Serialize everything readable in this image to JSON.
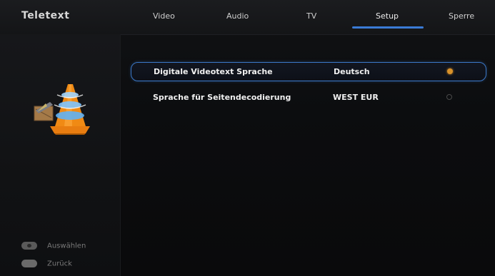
{
  "header": {
    "section_title": "Teletext",
    "tabs": [
      {
        "label": "Video"
      },
      {
        "label": "Audio"
      },
      {
        "label": "TV"
      },
      {
        "label": "Setup",
        "active": true
      },
      {
        "label": "Sperre"
      }
    ],
    "accent_color": "#3a7bd5"
  },
  "icon": "vlc-cone-icon",
  "settings": [
    {
      "label": "Digitale Videotext Sprache",
      "value": "Deutsch",
      "selected": true
    },
    {
      "label": "Sprache für Seitendecodierung",
      "value": "WEST EUR",
      "selected": false
    }
  ],
  "footer": {
    "hints": [
      {
        "icon": "ok-button-icon",
        "label": "Auswählen"
      },
      {
        "icon": "menu-button-icon",
        "label": "Zurück"
      }
    ]
  }
}
